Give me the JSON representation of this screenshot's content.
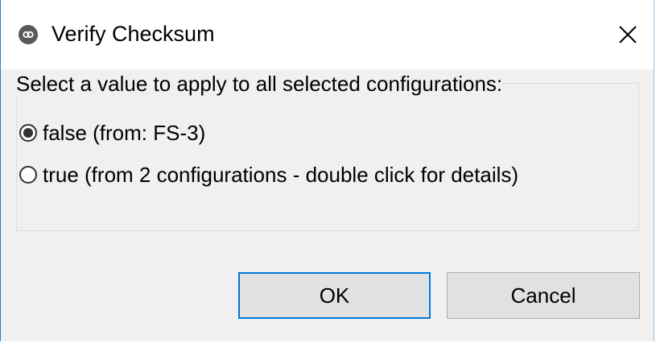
{
  "window": {
    "title": "Verify Checksum"
  },
  "group": {
    "legend": "Select a value to apply to all selected configurations:"
  },
  "options": [
    {
      "label": "false (from: FS-3)",
      "selected": true
    },
    {
      "label": "true (from 2 configurations - double click for details)",
      "selected": false
    }
  ],
  "buttons": {
    "ok": "OK",
    "cancel": "Cancel"
  },
  "colors": {
    "accent": "#0078d7",
    "window_border": "#2b7fd4",
    "dialog_bg": "#f0f0f0",
    "button_bg": "#e1e1e1"
  },
  "icons": {
    "app": "app-logo-icon",
    "close": "close-icon"
  }
}
